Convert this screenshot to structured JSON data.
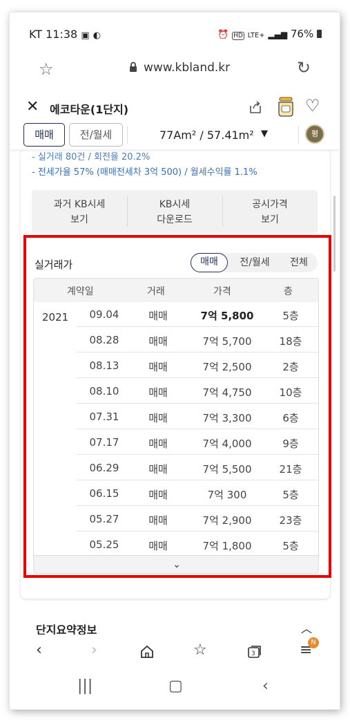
{
  "status_bar": {
    "carrier_time": "KT 11:38",
    "icons": [
      "image-icon",
      "moon-icon",
      "alarm-icon",
      "hd-icon",
      "lte-icon",
      "signal-icon",
      "battery-icon"
    ],
    "network": "LTE+",
    "battery": "76%"
  },
  "browser": {
    "url": "www.kbland.kr"
  },
  "header": {
    "title": "에코타운(1단지)"
  },
  "subbar": {
    "tabs": [
      "매매",
      "전/월세"
    ],
    "active_tab": "매매",
    "area": "77Am² / 57.41m²",
    "unit_toggle": "평"
  },
  "info_lines": [
    "- 실거래 80건 / 회전율 20.2%",
    "- 전세가율 57% (매매전세차 3억 500) / 월세수익률 1.1%"
  ],
  "action_buttons": [
    {
      "line1": "과거 KB시세",
      "line2": "보기"
    },
    {
      "line1": "KB시세",
      "line2": "다운로드"
    },
    {
      "line1": "공시가격",
      "line2": "보기"
    }
  ],
  "transactions": {
    "title": "실거래가",
    "filters": [
      "매매",
      "전/월세",
      "전체"
    ],
    "active_filter": "매매",
    "columns": [
      "계약일",
      "거래",
      "가격",
      "층"
    ],
    "year": "2021",
    "rows": [
      {
        "date": "09.04",
        "type": "매매",
        "price": "7억 5,800",
        "floor": "5층",
        "highlight": true
      },
      {
        "date": "08.28",
        "type": "매매",
        "price": "7억 5,700",
        "floor": "18층"
      },
      {
        "date": "08.13",
        "type": "매매",
        "price": "7억 2,500",
        "floor": "2층"
      },
      {
        "date": "08.10",
        "type": "매매",
        "price": "7억 4,750",
        "floor": "10층"
      },
      {
        "date": "07.31",
        "type": "매매",
        "price": "7억 3,300",
        "floor": "6층"
      },
      {
        "date": "07.17",
        "type": "매매",
        "price": "7억 4,000",
        "floor": "9층"
      },
      {
        "date": "06.29",
        "type": "매매",
        "price": "7억 5,500",
        "floor": "21층"
      },
      {
        "date": "06.15",
        "type": "매매",
        "price": "7억 300",
        "floor": "5층"
      },
      {
        "date": "05.27",
        "type": "매매",
        "price": "7억 2,900",
        "floor": "23층"
      },
      {
        "date": "05.25",
        "type": "매매",
        "price": "7억 1,800",
        "floor": "5층"
      }
    ]
  },
  "summary": {
    "title": "단지요약정보"
  },
  "bottom_nav": {
    "badge": "N"
  },
  "colors": {
    "accent": "#1e2f55",
    "info_blue": "#3a6fb5",
    "highlight_box": "#e80000",
    "badge": "#ea8a2e"
  }
}
